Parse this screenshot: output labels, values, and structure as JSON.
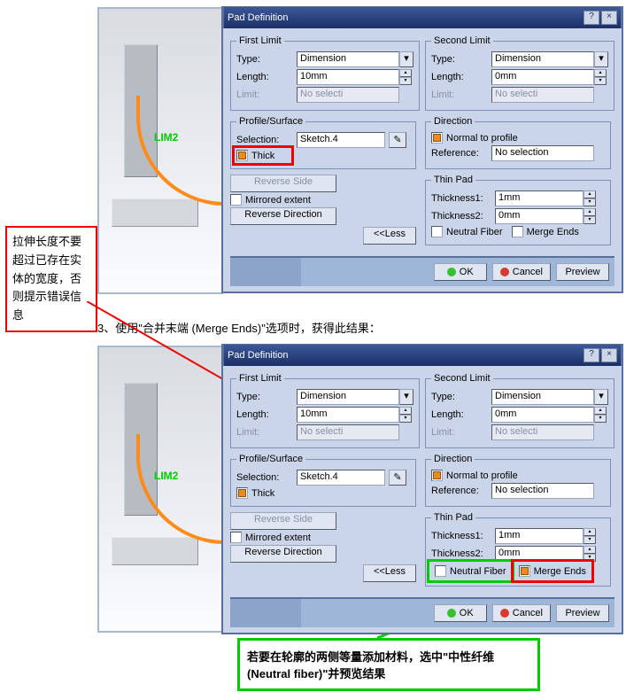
{
  "dialog_title": "Pad Definition",
  "caption3": "3、使用\"合并末端 (Merge Ends)\"选项时，获得此结果：",
  "note_red": "拉伸长度不要超过已存在实体的宽度，否则提示错误信息",
  "note_green": "若要在轮廓的两侧等量添加材料，选中\"中性纤维 (Neutral fiber)\"并预览结果",
  "lim_label": "LIM2",
  "first_limit": {
    "legend": "First Limit",
    "type_label": "Type:",
    "type_value": "Dimension",
    "length_label": "Length:",
    "length_value": "10mm",
    "limit_label": "Limit:",
    "limit_value": "No selecti"
  },
  "second_limit": {
    "legend": "Second Limit",
    "type_label": "Type:",
    "type_value": "Dimension",
    "length_label": "Length:",
    "length_value": "0mm",
    "limit_label": "Limit:",
    "limit_value": "No selecti"
  },
  "profile": {
    "legend": "Profile/Surface",
    "selection_label": "Selection:",
    "selection_value": "Sketch.4",
    "thick_label": "Thick",
    "reverse_side": "Reverse Side",
    "mirrored": "Mirrored extent",
    "reverse_dir": "Reverse Direction"
  },
  "direction": {
    "legend": "Direction",
    "normal": "Normal to profile",
    "reference_label": "Reference:",
    "reference_value": "No selection"
  },
  "thin": {
    "legend": "Thin Pad",
    "t1_label": "Thickness1:",
    "t1_value": "1mm",
    "t2_label": "Thickness2:",
    "t2_value": "0mm",
    "neutral": "Neutral Fiber",
    "merge": "Merge Ends"
  },
  "less_btn": "<<Less",
  "ok": "OK",
  "cancel": "Cancel",
  "preview": "Preview"
}
